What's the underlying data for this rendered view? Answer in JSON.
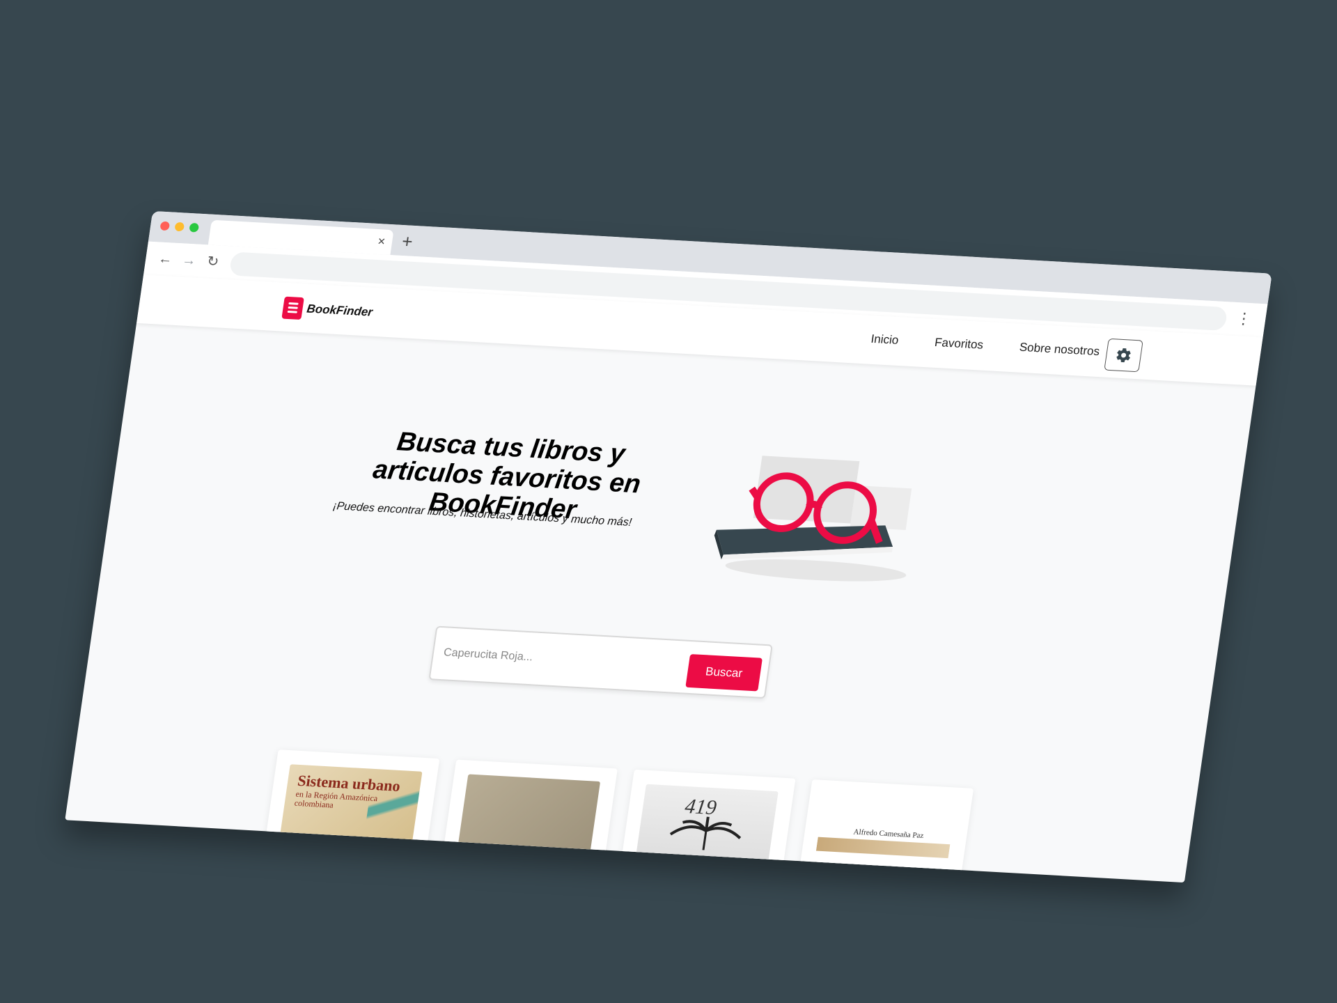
{
  "browser": {
    "tab": {
      "close_glyph": "×"
    },
    "new_tab_glyph": "+",
    "toolbar": {
      "back_glyph": "←",
      "forward_glyph": "→",
      "reload_glyph": "↻",
      "menu_glyph": "⋮"
    }
  },
  "header": {
    "logo_text": "BookFinder",
    "nav": [
      "Inicio",
      "Favoritos",
      "Sobre nosotros"
    ],
    "settings_icon": "gear-icon"
  },
  "hero": {
    "title": "Busca tus libros y articulos favoritos en BookFinder",
    "subtitle": "¡Puedes encontrar libros, historietas, artículos y mucho más!"
  },
  "search": {
    "placeholder": "Caperucita Roja...",
    "value": "",
    "button_label": "Buscar"
  },
  "books": [
    {
      "cover_title": "Sistema urbano",
      "cover_subtitle": "en la Región Amazónica colombiana"
    },
    {
      "cover_title": ""
    },
    {
      "cover_title": "419"
    },
    {
      "cover_top_text": "",
      "cover_author": "Alfredo Camesaña Paz"
    }
  ],
  "colors": {
    "accent": "#ec0c45",
    "background": "#37474f",
    "page": "#f8f9fa"
  }
}
